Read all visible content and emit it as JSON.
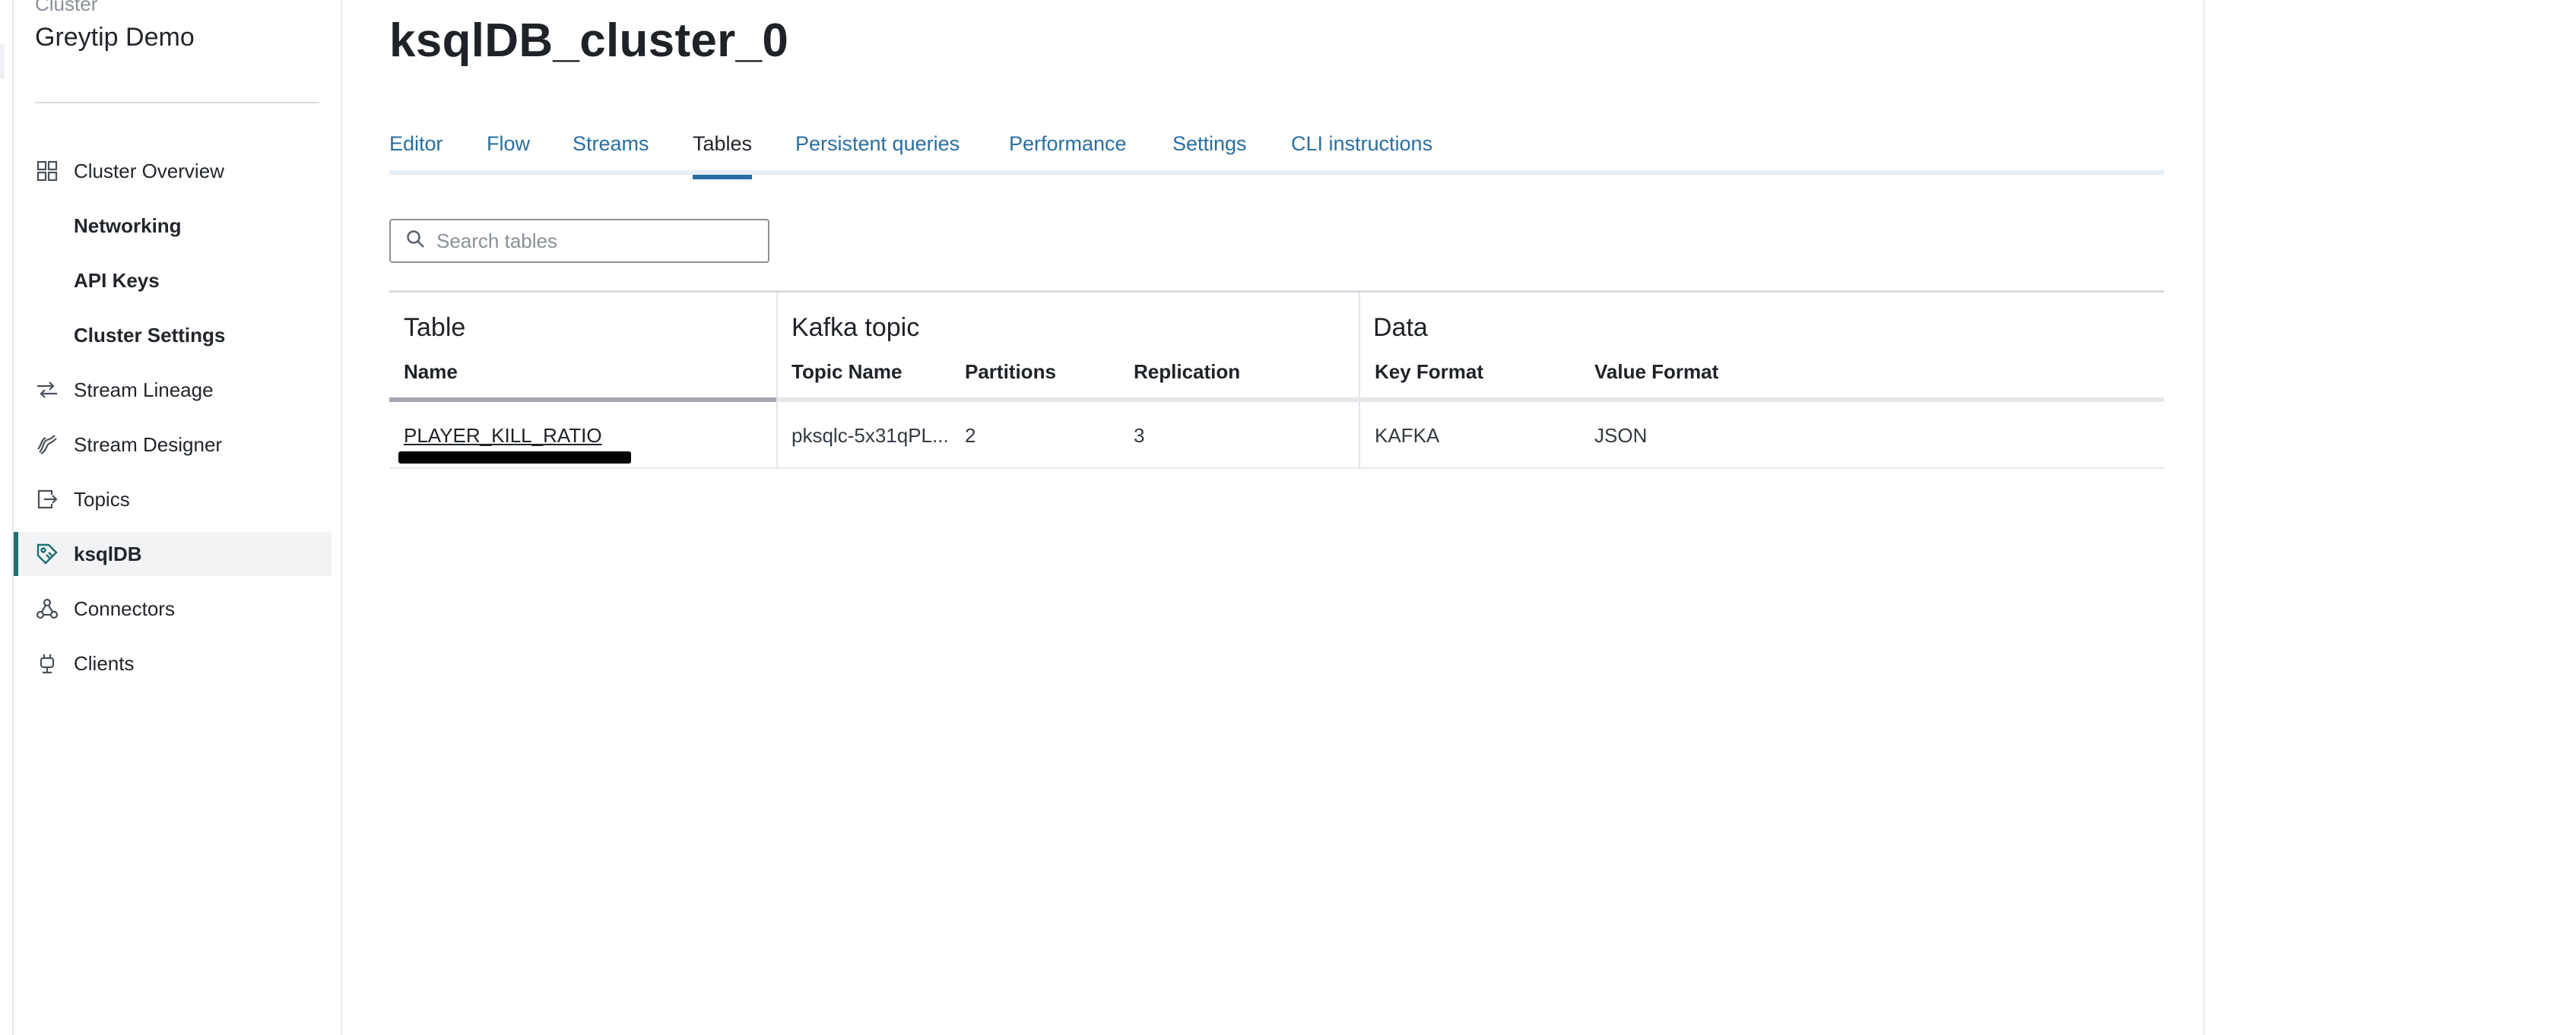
{
  "sidebar": {
    "cluster_label": "Cluster",
    "cluster_name": "Greytip Demo",
    "items": [
      {
        "label": "Cluster Overview",
        "icon": "grid-icon"
      },
      {
        "label": "Networking"
      },
      {
        "label": "API Keys"
      },
      {
        "label": "Cluster Settings"
      },
      {
        "label": "Stream Lineage",
        "icon": "lineage-icon"
      },
      {
        "label": "Stream Designer",
        "icon": "designer-icon"
      },
      {
        "label": "Topics",
        "icon": "topics-icon"
      },
      {
        "label": "ksqlDB",
        "icon": "ksqldb-icon",
        "active": true
      },
      {
        "label": "Connectors",
        "icon": "connectors-icon"
      },
      {
        "label": "Clients",
        "icon": "clients-icon"
      }
    ]
  },
  "main": {
    "title": "ksqlDB_cluster_0",
    "tabs": [
      {
        "label": "Editor"
      },
      {
        "label": "Flow"
      },
      {
        "label": "Streams"
      },
      {
        "label": "Tables",
        "active": true
      },
      {
        "label": "Persistent queries"
      },
      {
        "label": "Performance"
      },
      {
        "label": "Settings"
      },
      {
        "label": "CLI instructions"
      }
    ],
    "search": {
      "placeholder": "Search tables",
      "value": ""
    },
    "table": {
      "groups": [
        "Table",
        "Kafka topic",
        "Data"
      ],
      "columns": [
        "Name",
        "Topic Name",
        "Partitions",
        "Replication",
        "Key Format",
        "Value Format"
      ],
      "rows": [
        {
          "name": "PLAYER_KILL_RATIO",
          "topic_name": "pksqlc-5x31qPL...",
          "partitions": "2",
          "replication": "3",
          "key_format": "KAFKA",
          "value_format": "JSON"
        }
      ]
    }
  },
  "colors": {
    "accent": "#2a6fa0",
    "active_indicator": "#1d6f72",
    "text": "#1f2328"
  }
}
